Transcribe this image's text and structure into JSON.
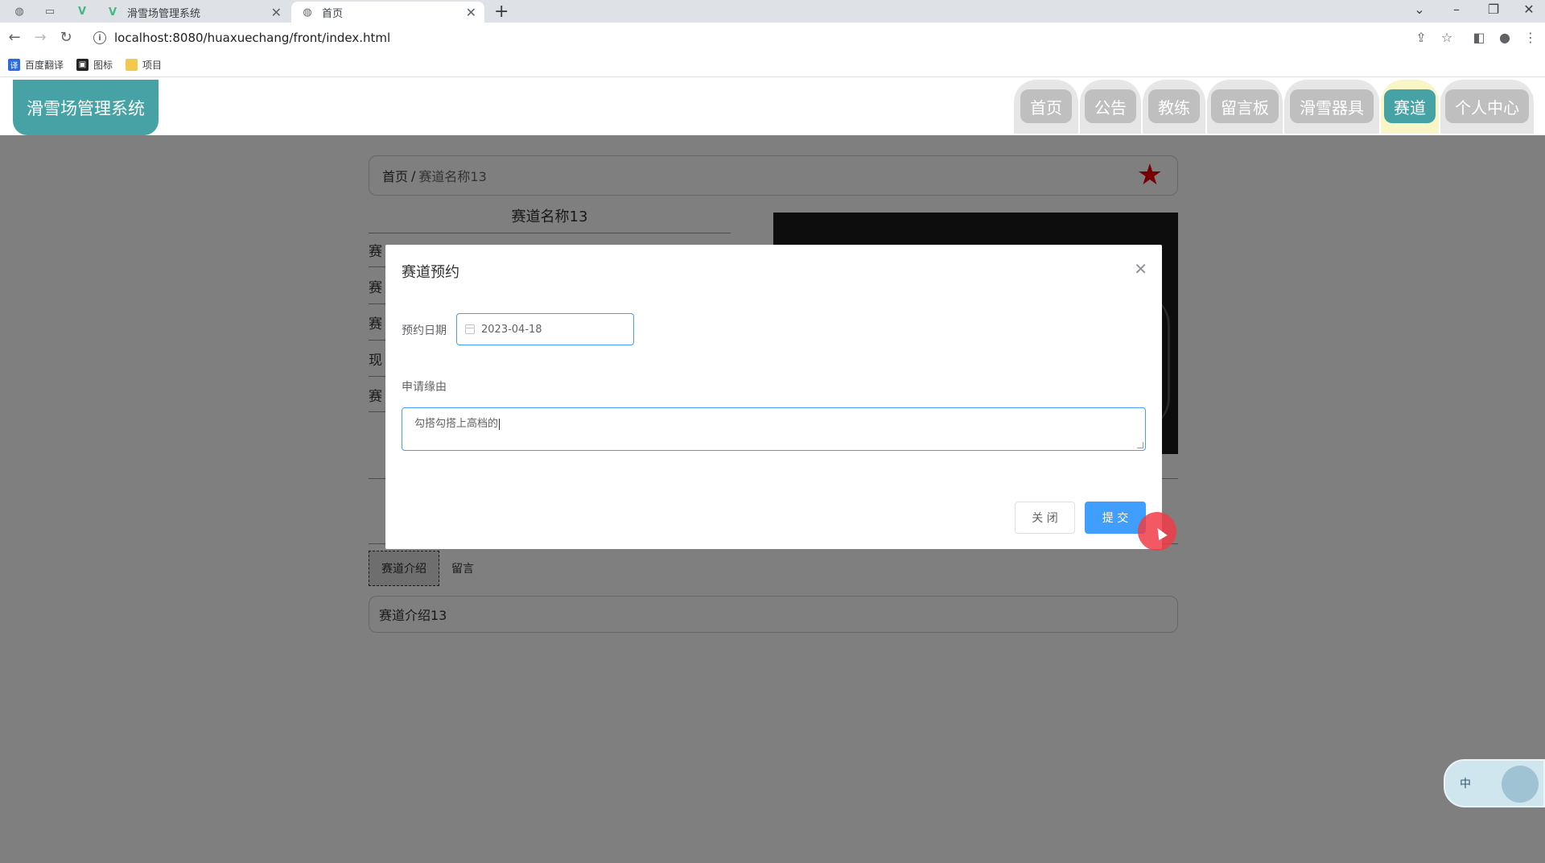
{
  "browser": {
    "tabs": [
      {
        "title": "滑雪场管理系统",
        "active": false
      },
      {
        "title": "首页",
        "active": true
      }
    ],
    "url": "localhost:8080/huaxuechang/front/index.html",
    "bookmarks": [
      "百度翻译",
      "图标",
      "项目"
    ]
  },
  "header": {
    "logo": "滑雪场管理系统",
    "nav": [
      "首页",
      "公告",
      "教练",
      "留言板",
      "滑雪器具",
      "赛道",
      "个人中心"
    ],
    "active_nav": "赛道"
  },
  "breadcrumb": {
    "home": "首页",
    "separator": "/",
    "current": "赛道名称13"
  },
  "detail": {
    "title": "赛道名称13",
    "row_labels": [
      "赛",
      "赛",
      "赛",
      "现",
      "赛"
    ]
  },
  "tabs": [
    "赛道介绍",
    "留言"
  ],
  "intro_text": "赛道介绍13",
  "modal": {
    "title": "赛道预约",
    "date_label": "预约日期",
    "date_value": "2023-04-18",
    "reason_label": "申请缘由",
    "reason_value": "勾搭勾搭上高档的",
    "close_button": "关 闭",
    "submit_button": "提 交"
  },
  "ime": {
    "label": "中"
  },
  "colors": {
    "accent": "#409eff",
    "brand": "#46a2a4",
    "star": "#e00000"
  }
}
